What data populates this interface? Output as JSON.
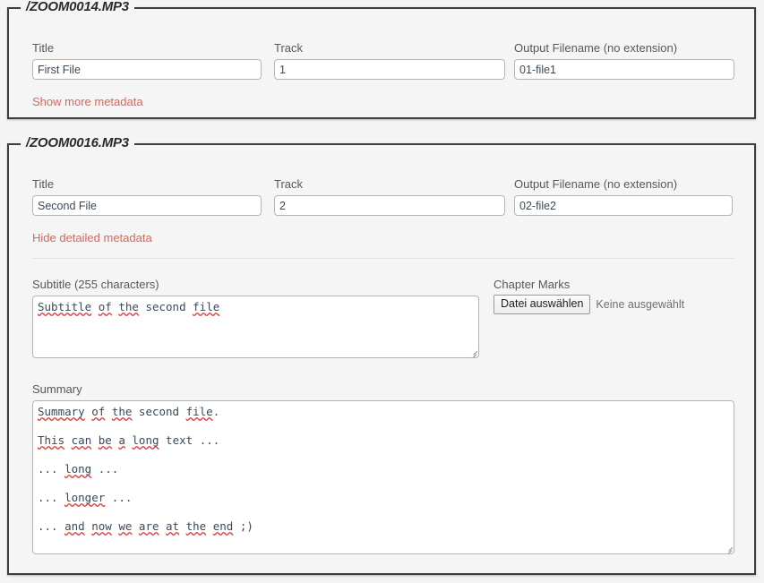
{
  "colors": {
    "page_background": "#f4f4f4",
    "panel_background": "#f5f5f5",
    "panel_border": "#3d3d3d",
    "label_text": "#58585a",
    "input_text": "#3a4a5a",
    "link_red": "#d9675f",
    "separator": "#e2e2e2",
    "spellcheck_underline": "#e03030"
  },
  "files": [
    {
      "legend": "/ZOOM0014.MP3",
      "fields": {
        "title": {
          "label": "Title",
          "value": "First File"
        },
        "track": {
          "label": "Track",
          "value": "1"
        },
        "output": {
          "label": "Output Filename (no extension)",
          "value": "01-file1"
        }
      },
      "toggle_label": "Show more metadata",
      "expanded": false
    },
    {
      "legend": "/ZOOM0016.MP3",
      "fields": {
        "title": {
          "label": "Title",
          "value": "Second File"
        },
        "track": {
          "label": "Track",
          "value": "2"
        },
        "output": {
          "label": "Output Filename (no extension)",
          "value": "02-file2"
        }
      },
      "toggle_label": "Hide detailed metadata",
      "expanded": true,
      "details": {
        "subtitle": {
          "label": "Subtitle (255 characters)",
          "value": "Subtitle of the second file"
        },
        "chapter_marks": {
          "label": "Chapter Marks",
          "button_label": "Datei auswählen",
          "status_text": "Keine ausgewählt"
        },
        "summary": {
          "label": "Summary",
          "value": "Summary of the second file.\n\nThis can be a long text ...\n\n... long ...\n\n... longer ...\n\n... and now we are at the end ;)"
        }
      }
    }
  ]
}
